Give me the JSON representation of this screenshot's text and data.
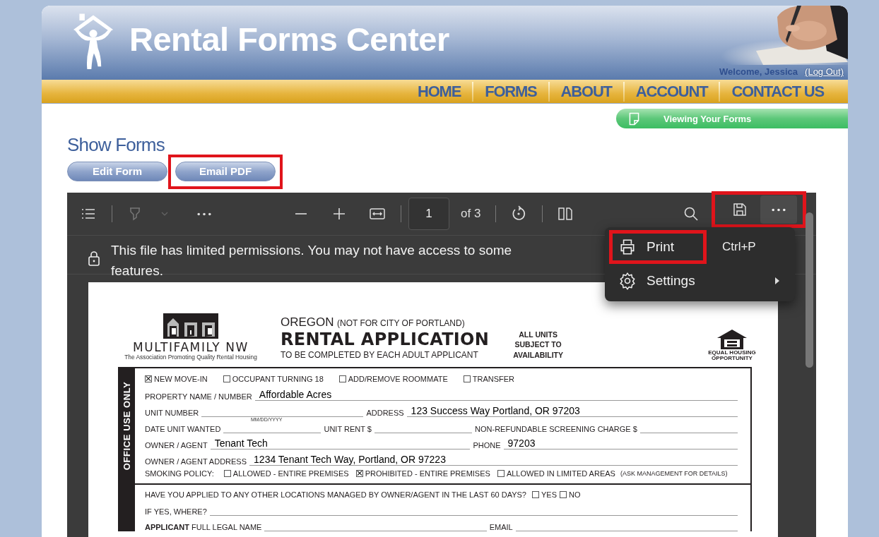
{
  "header": {
    "site_name": "Rental Forms Center",
    "welcome": "Welcome, Jessica",
    "logout": "(Log Out)"
  },
  "nav": [
    {
      "label": "HOME"
    },
    {
      "label": "FORMS"
    },
    {
      "label": "ABOUT"
    },
    {
      "label": "ACCOUNT"
    },
    {
      "label": "CONTACT US"
    }
  ],
  "status_tab": {
    "label": "Viewing Your Forms"
  },
  "page_title": "Show Forms",
  "buttons": [
    {
      "label": "Edit Form",
      "highlighted": false
    },
    {
      "label": "Email PDF",
      "highlighted": true
    }
  ],
  "viewer": {
    "page_number": "1",
    "page_count": "of 3",
    "save_highlighted": true,
    "notice": "This file has limited permissions. You may not have access to some features.",
    "menu": [
      {
        "kind": "print",
        "label": "Print",
        "shortcut": "Ctrl+P",
        "highlighted": true
      },
      {
        "kind": "settings",
        "label": "Settings",
        "highlighted": false
      }
    ]
  },
  "document": {
    "org_name": "MULTIFAMILY NW",
    "org_tagline": "The Association Promoting Quality Rental Housing",
    "state": "OREGON",
    "state_note": "(NOT FOR CITY OF PORTLAND)",
    "title": "RENTAL APPLICATION",
    "subtitle": "TO BE COMPLETED BY EACH ADULT APPLICANT",
    "availability": [
      "ALL UNITS",
      "SUBJECT TO",
      "AVAILABILITY"
    ],
    "eho_label": "EQUAL HOUSING OPPORTUNITY",
    "office": {
      "side_label": "OFFICE USE ONLY",
      "types": [
        {
          "label": "NEW MOVE-IN",
          "checked": true
        },
        {
          "label": "OCCUPANT TURNING 18",
          "checked": false
        },
        {
          "label": "ADD/REMOVE ROOMMATE",
          "checked": false
        },
        {
          "label": "TRANSFER",
          "checked": false
        }
      ],
      "rows": [
        [
          {
            "label": "PROPERTY NAME / NUMBER",
            "value": "Affordable Acres"
          }
        ],
        [
          {
            "label": "UNIT NUMBER"
          },
          {
            "label": "ADDRESS",
            "value": "123 Success Way Portland, OR 97203"
          }
        ],
        [
          {
            "label": "DATE UNIT WANTED",
            "hint": "MM/DD/YYYY"
          },
          {
            "label": "UNIT RENT $"
          },
          {
            "label": "NON-REFUNDABLE SCREENING CHARGE $"
          }
        ],
        [
          {
            "label": "OWNER / AGENT",
            "value": "Tenant Tech"
          },
          {
            "label": "PHONE",
            "value": "97203"
          }
        ],
        [
          {
            "label": "OWNER / AGENT ADDRESS",
            "value": "1234 Tenant Tech Way, Portland, OR 97223"
          }
        ]
      ],
      "smoking_label": "SMOKING POLICY:",
      "smoking": [
        {
          "label": "ALLOWED - ENTIRE PREMISES",
          "checked": false
        },
        {
          "label": "PROHIBITED - ENTIRE PREMISES",
          "checked": true
        },
        {
          "label": "ALLOWED IN LIMITED AREAS",
          "note": "(ASK MANAGEMENT FOR DETAILS)",
          "checked": false
        }
      ]
    },
    "applicant": {
      "question": "HAVE YOU APPLIED TO ANY OTHER LOCATIONS MANAGED BY OWNER/AGENT IN THE LAST 60 DAYS?",
      "answers": [
        {
          "label": "YES",
          "checked": false
        },
        {
          "label": "NO",
          "checked": false
        }
      ],
      "rows": [
        [
          {
            "label": "IF YES, WHERE?"
          }
        ],
        [
          {
            "label": "**APPLICANT** FULL LEGAL NAME"
          },
          {
            "label": "EMAIL"
          }
        ]
      ]
    }
  }
}
